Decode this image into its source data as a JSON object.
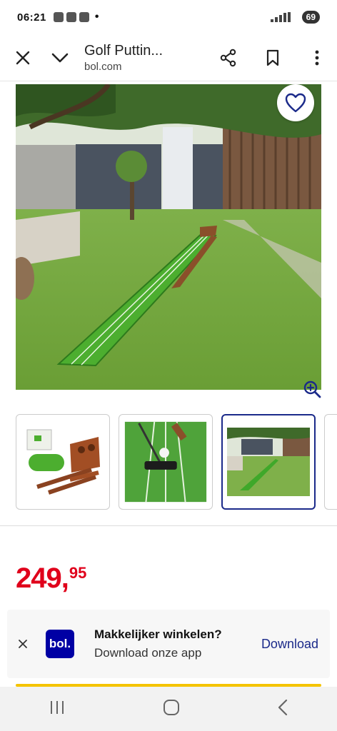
{
  "status": {
    "time": "06:21",
    "battery": "69"
  },
  "appbar": {
    "title": "Golf Puttin...",
    "url": "bol.com"
  },
  "icons": {
    "close": "close-icon",
    "chevron": "chevron-down-icon",
    "share": "share-icon",
    "bookmark": "bookmark-icon",
    "more": "more-vert-icon",
    "heart": "heart-icon",
    "zoom": "zoom-in-icon"
  },
  "product": {
    "price_main": "249",
    "price_comma": ",",
    "price_cents": "95"
  },
  "banner": {
    "logo": "bol.",
    "headline": "Makkelijker winkelen?",
    "subline": "Download onze app",
    "download_label": "Download"
  },
  "colors": {
    "price": "#e0001b",
    "brand": "#0000a4",
    "link": "#1b2a8a",
    "accent": "#f5c400"
  }
}
